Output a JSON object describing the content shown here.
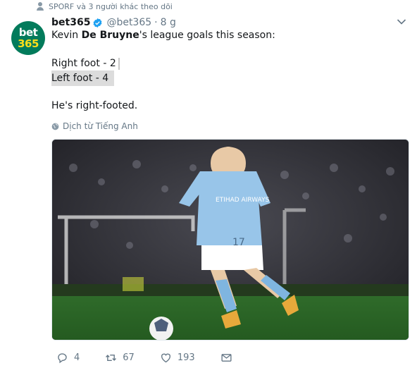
{
  "social_context": {
    "text": "SPORF và 3 người khác theo dõi",
    "icon": "person-icon"
  },
  "author": {
    "avatar_line1": "bet",
    "avatar_line2": "365",
    "name": "bet365",
    "handle": "@bet365",
    "separator": "·",
    "time": "8 g",
    "verified_icon": "verified-badge-icon"
  },
  "tweet": {
    "line1_pre": "Kevin ",
    "line1_bold": "De Bruyne",
    "line1_post": "'s league goals this season:",
    "line2": "Right foot - 2",
    "line3": "Left foot - 4",
    "line4": "He's right-footed."
  },
  "translate": {
    "label": "Dịch từ Tiếng Anh",
    "icon": "globe-icon"
  },
  "media": {
    "description_icon": "photo-icon",
    "jersey_number": "17",
    "sponsor": "ETIHAD AIRWAYS"
  },
  "actions": {
    "reply_count": "4",
    "retweet_count": "67",
    "like_count": "193"
  },
  "colors": {
    "accent": "#1da1f2",
    "secondary_text": "#657786",
    "avatar_bg": "#027b5b",
    "avatar_accent": "#ffdf1b",
    "selection": "#dcdcdc"
  }
}
